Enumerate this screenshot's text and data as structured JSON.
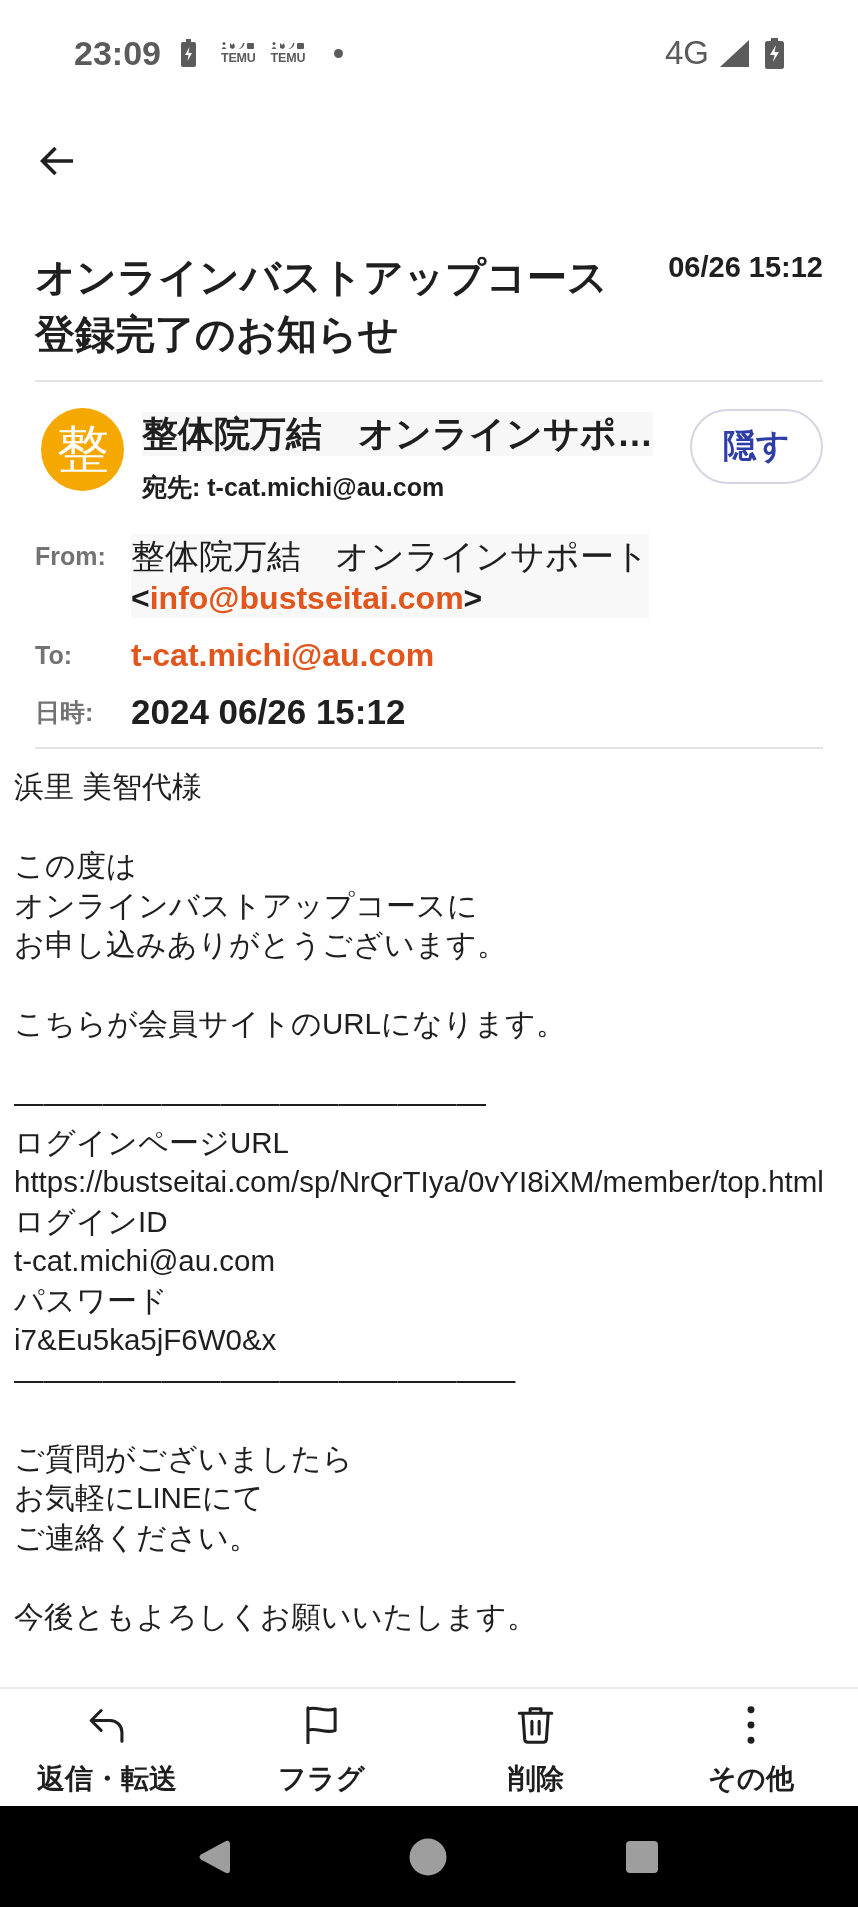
{
  "status_bar": {
    "time": "23:09",
    "notifications": [
      {
        "label": "TEMU"
      },
      {
        "label": "TEMU"
      }
    ],
    "network": "4G"
  },
  "message": {
    "subject": "オンラインバストアップコース登録完了のお知らせ",
    "date": "06/26 15:12"
  },
  "sender": {
    "avatar_letter": "整",
    "name": "整体院万結　オンラインサポ…",
    "recipient_line": "宛先: t-cat.michi@au.com",
    "hide_button": "隠す"
  },
  "details": [
    {
      "kind": "sender",
      "label": "From:",
      "name": "整体院万結　オンラインサポート",
      "bracket_open": "<",
      "email": "info@bustseitai.com",
      "bracket_close": ">"
    },
    {
      "kind": "address",
      "label": "To:",
      "email": "t-cat.michi@au.com"
    },
    {
      "kind": "text",
      "label": "日時:",
      "value": "2024 06/26 15:12"
    }
  ],
  "body": {
    "paragraphs": [
      [
        "浜里 美智代様"
      ],
      [
        "この度は",
        "オンラインバストアップコースに",
        "お申し込みありがとうございます。"
      ],
      [
        "こちらが会員サイトのURLになります。"
      ],
      [
        "————————————————",
        "ログインページURL",
        "https://bustseitai.com/sp/NrQrTIya/0vYI8iXM/member/top.html",
        "ログインID",
        "t-cat.michi@au.com",
        "パスワード",
        "i7&Eu5ka5jF6W0&x",
        "—————————————————"
      ],
      [
        "ご質問がございましたら",
        "お気軽にLINEにて",
        "ご連絡ください。"
      ],
      [
        "今後ともよろしくお願いいたします。"
      ]
    ]
  },
  "actions": [
    {
      "label": "返信・転送"
    },
    {
      "label": "フラグ"
    },
    {
      "label": "削除"
    },
    {
      "label": "その他"
    }
  ]
}
